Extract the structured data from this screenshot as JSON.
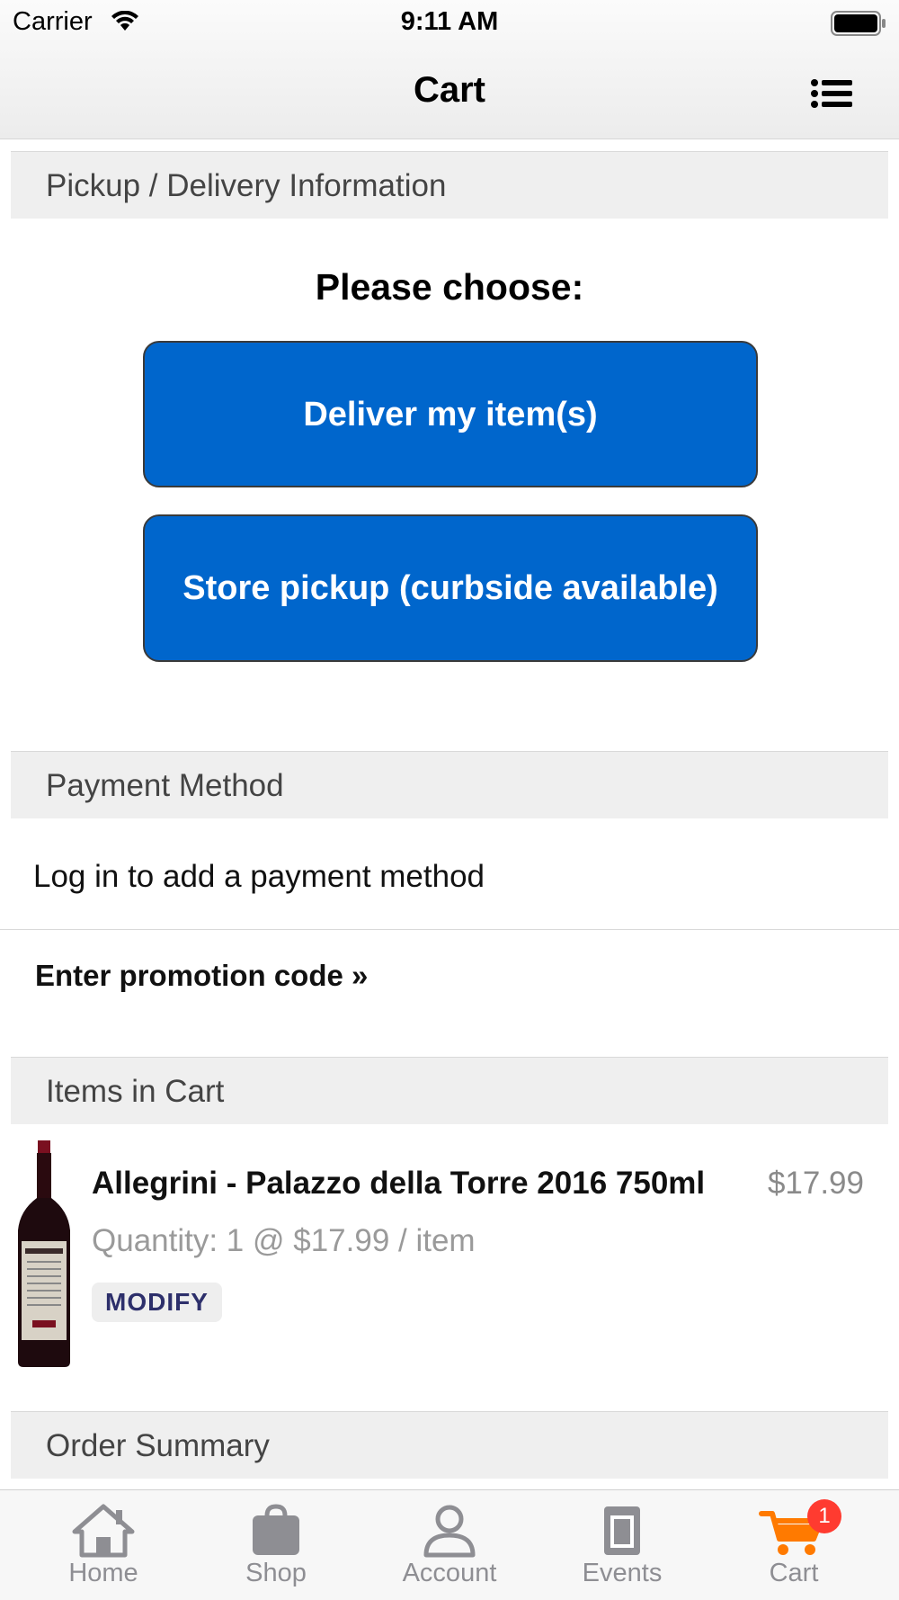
{
  "status_bar": {
    "carrier": "Carrier",
    "time": "9:11 AM"
  },
  "nav": {
    "title": "Cart",
    "menu_icon": "list-icon"
  },
  "sections": {
    "pickup_delivery": "Pickup / Delivery Information",
    "payment_method": "Payment Method",
    "items_in_cart": "Items in Cart",
    "order_summary": "Order Summary"
  },
  "fulfillment": {
    "prompt": "Please choose:",
    "deliver_label": "Deliver my item(s)",
    "pickup_label": "Store pickup (curbside available)"
  },
  "payment": {
    "message": "Log in to add a payment method"
  },
  "promo": {
    "label": "Enter promotion code »"
  },
  "cart_items": [
    {
      "name": "Allegrini - Palazzo della Torre 2016 750ml",
      "price": "$17.99",
      "quantity_text": "Quantity: 1 @ $17.99 / item",
      "modify_label": "MODIFY"
    }
  ],
  "tabs": [
    {
      "label": "Home",
      "icon": "home-icon"
    },
    {
      "label": "Shop",
      "icon": "shopping-bag-icon"
    },
    {
      "label": "Account",
      "icon": "person-icon"
    },
    {
      "label": "Events",
      "icon": "calendar-icon"
    },
    {
      "label": "Cart",
      "icon": "cart-icon",
      "badge": "1",
      "active": true
    }
  ],
  "colors": {
    "primary_button": "#0066cc",
    "active_tab": "#ff7a00",
    "badge": "#ff3b30",
    "section_header_bg": "#efefef"
  }
}
